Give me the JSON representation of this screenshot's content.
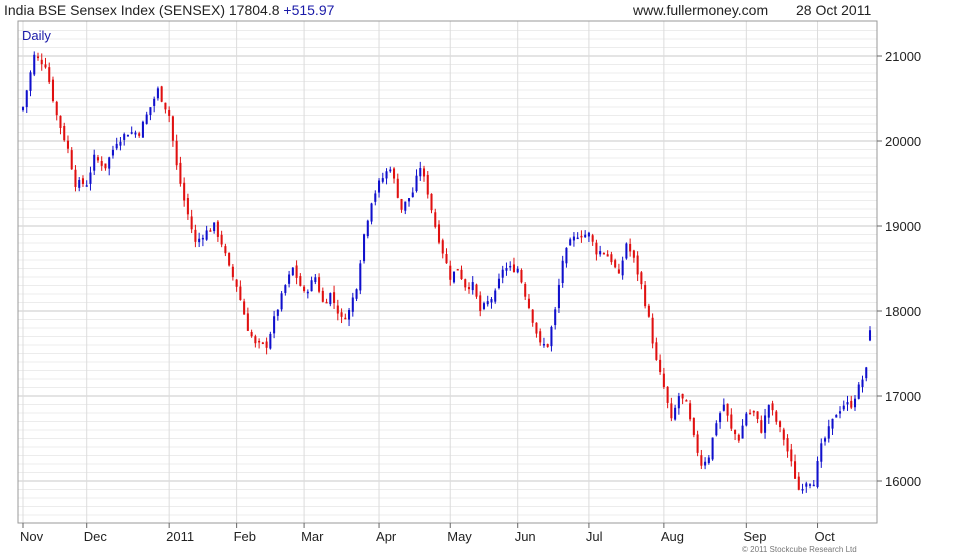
{
  "header": {
    "title": "India BSE Sensex Index (SENSEX)",
    "last": "17804.8",
    "change": "+515.97",
    "site": "www.fullermoney.com",
    "date": "28 Oct 2011"
  },
  "footer": {
    "copyright": "© 2011 Stockcube Research Ltd"
  },
  "colors": {
    "up": "#1010cc",
    "down": "#e01010",
    "grid": "#dddddd",
    "frame": "#999999",
    "accent": "#1a1aa8"
  },
  "chart_data": {
    "type": "candlestick",
    "periodicity_label": "Daily",
    "ylim": [
      15500,
      21400
    ],
    "y_ticks": [
      16000,
      17000,
      18000,
      19000,
      20000,
      21000
    ],
    "y_axis_side": "right",
    "x_tick_labels": [
      "Nov",
      "Dec",
      "2011",
      "Feb",
      "Mar",
      "Apr",
      "May",
      "Jun",
      "Jul",
      "Aug",
      "Sep",
      "Oct"
    ],
    "x_tick_day_index": [
      0,
      17,
      39,
      57,
      75,
      95,
      114,
      132,
      151,
      171,
      193,
      212
    ],
    "grid": true,
    "series": [
      {
        "close_points": [
          [
            0,
            20400
          ],
          [
            3,
            21000
          ],
          [
            6,
            20900
          ],
          [
            9,
            20300
          ],
          [
            12,
            19900
          ],
          [
            14,
            19500
          ],
          [
            17,
            19500
          ],
          [
            19,
            19800
          ],
          [
            22,
            19700
          ],
          [
            25,
            20000
          ],
          [
            28,
            20100
          ],
          [
            31,
            20100
          ],
          [
            34,
            20400
          ],
          [
            36,
            20600
          ],
          [
            39,
            20300
          ],
          [
            41,
            19700
          ],
          [
            43,
            19300
          ],
          [
            46,
            18800
          ],
          [
            48,
            18900
          ],
          [
            51,
            19000
          ],
          [
            53,
            18800
          ],
          [
            55,
            18500
          ],
          [
            57,
            18300
          ],
          [
            60,
            17800
          ],
          [
            62,
            17600
          ],
          [
            65,
            17600
          ],
          [
            67,
            17900
          ],
          [
            70,
            18300
          ],
          [
            72,
            18500
          ],
          [
            75,
            18200
          ],
          [
            78,
            18400
          ],
          [
            80,
            18100
          ],
          [
            82,
            18200
          ],
          [
            85,
            17900
          ],
          [
            87,
            18000
          ],
          [
            89,
            18300
          ],
          [
            91,
            18900
          ],
          [
            93,
            19300
          ],
          [
            95,
            19500
          ],
          [
            98,
            19700
          ],
          [
            101,
            19200
          ],
          [
            104,
            19400
          ],
          [
            106,
            19700
          ],
          [
            108,
            19400
          ],
          [
            110,
            19000
          ],
          [
            112,
            18700
          ],
          [
            114,
            18400
          ],
          [
            116,
            18500
          ],
          [
            118,
            18300
          ],
          [
            120,
            18300
          ],
          [
            122,
            18000
          ],
          [
            124,
            18100
          ],
          [
            126,
            18200
          ],
          [
            128,
            18500
          ],
          [
            130,
            18500
          ],
          [
            132,
            18500
          ],
          [
            134,
            18200
          ],
          [
            136,
            17900
          ],
          [
            138,
            17600
          ],
          [
            140,
            17600
          ],
          [
            142,
            18000
          ],
          [
            144,
            18600
          ],
          [
            146,
            18800
          ],
          [
            148,
            18900
          ],
          [
            151,
            18900
          ],
          [
            153,
            18700
          ],
          [
            155,
            18700
          ],
          [
            157,
            18600
          ],
          [
            159,
            18400
          ],
          [
            161,
            18800
          ],
          [
            163,
            18600
          ],
          [
            165,
            18300
          ],
          [
            167,
            17900
          ],
          [
            169,
            17400
          ],
          [
            171,
            17100
          ],
          [
            173,
            16700
          ],
          [
            175,
            17000
          ],
          [
            177,
            16900
          ],
          [
            179,
            16500
          ],
          [
            181,
            16200
          ],
          [
            183,
            16300
          ],
          [
            185,
            16700
          ],
          [
            187,
            16900
          ],
          [
            189,
            16600
          ],
          [
            191,
            16500
          ],
          [
            193,
            16800
          ],
          [
            195,
            16800
          ],
          [
            197,
            16600
          ],
          [
            199,
            16900
          ],
          [
            201,
            16700
          ],
          [
            203,
            16500
          ],
          [
            205,
            16200
          ],
          [
            207,
            15900
          ],
          [
            209,
            16000
          ],
          [
            211,
            16000
          ],
          [
            213,
            16400
          ],
          [
            215,
            16600
          ],
          [
            217,
            16800
          ],
          [
            219,
            16900
          ],
          [
            221,
            16900
          ],
          [
            223,
            17100
          ],
          [
            225,
            17300
          ],
          [
            226,
            17804.8
          ]
        ]
      }
    ]
  }
}
